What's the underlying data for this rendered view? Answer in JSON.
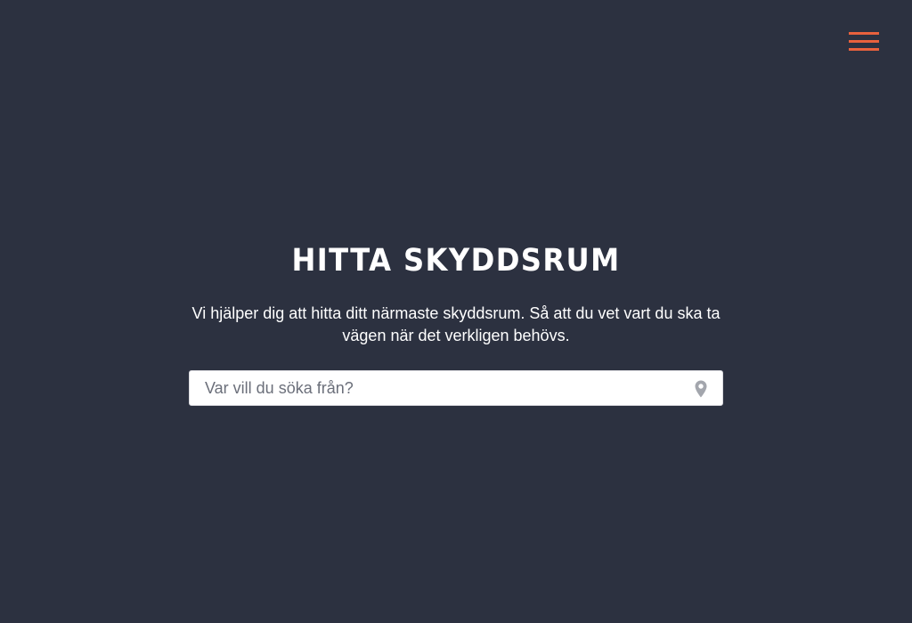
{
  "header": {
    "menu_icon": "hamburger-menu-icon",
    "accent_color": "#e8613d"
  },
  "hero": {
    "title": "HITTA SKYDDSRUM",
    "subtitle": "Vi hjälper dig att hitta ditt närmaste skyddsrum. Så att du vet vart du ska ta vägen när det verkligen behövs."
  },
  "search": {
    "placeholder": "Var vill du söka från?",
    "value": "",
    "location_icon": "map-pin-icon"
  },
  "colors": {
    "background": "#2c3140",
    "text": "#ffffff",
    "accent": "#e8613d",
    "icon_muted": "#a3a6ad"
  }
}
